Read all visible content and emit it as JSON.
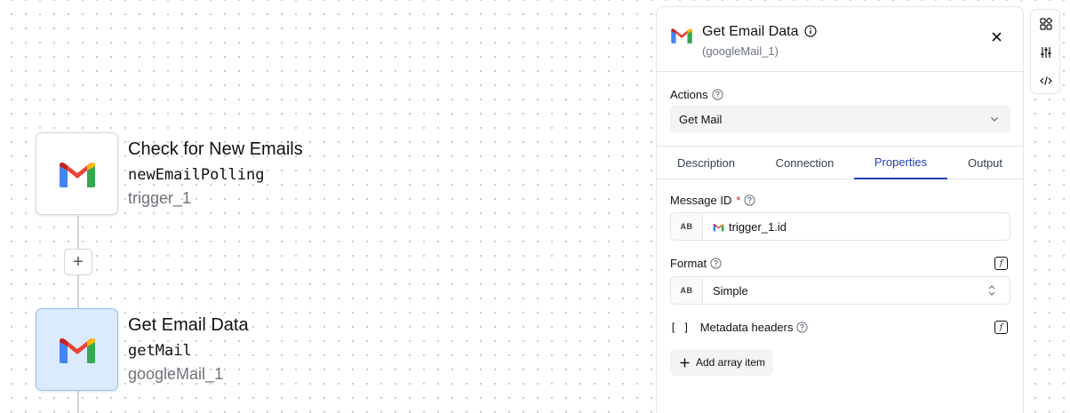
{
  "canvas": {
    "nodes": [
      {
        "title": "Check for New Emails",
        "function": "newEmailPolling",
        "id": "trigger_1",
        "icon": "gmail-icon",
        "selected": false
      },
      {
        "title": "Get Email Data",
        "function": "getMail",
        "id": "googleMail_1",
        "icon": "gmail-icon",
        "selected": true
      }
    ],
    "add_node_label": "+"
  },
  "panel": {
    "title": "Get Email Data",
    "subtitle": "(googleMail_1)",
    "actions_label": "Actions",
    "actions_value": "Get Mail",
    "tabs": [
      {
        "label": "Description",
        "active": false
      },
      {
        "label": "Connection",
        "active": false
      },
      {
        "label": "Properties",
        "active": true
      },
      {
        "label": "Output",
        "active": false
      }
    ],
    "message_id": {
      "label": "Message ID",
      "required_mark": "*",
      "type_badge": "AB",
      "value": "trigger_1.id"
    },
    "format": {
      "label": "Format",
      "type_badge": "AB",
      "value": "Simple"
    },
    "metadata_headers": {
      "bracket": "[ ]",
      "label": "Metadata headers"
    },
    "add_array_item_label": "Add array item"
  },
  "toolbar": {
    "icons": [
      "components-icon",
      "sliders-icon",
      "code-icon"
    ]
  },
  "colors": {
    "accent": "#1e40af",
    "selected_node_bg": "#dbeafe",
    "gmail_red": "#ea4335",
    "gmail_blue": "#4285f4",
    "gmail_green": "#34a853",
    "gmail_yellow": "#fbbc04"
  }
}
